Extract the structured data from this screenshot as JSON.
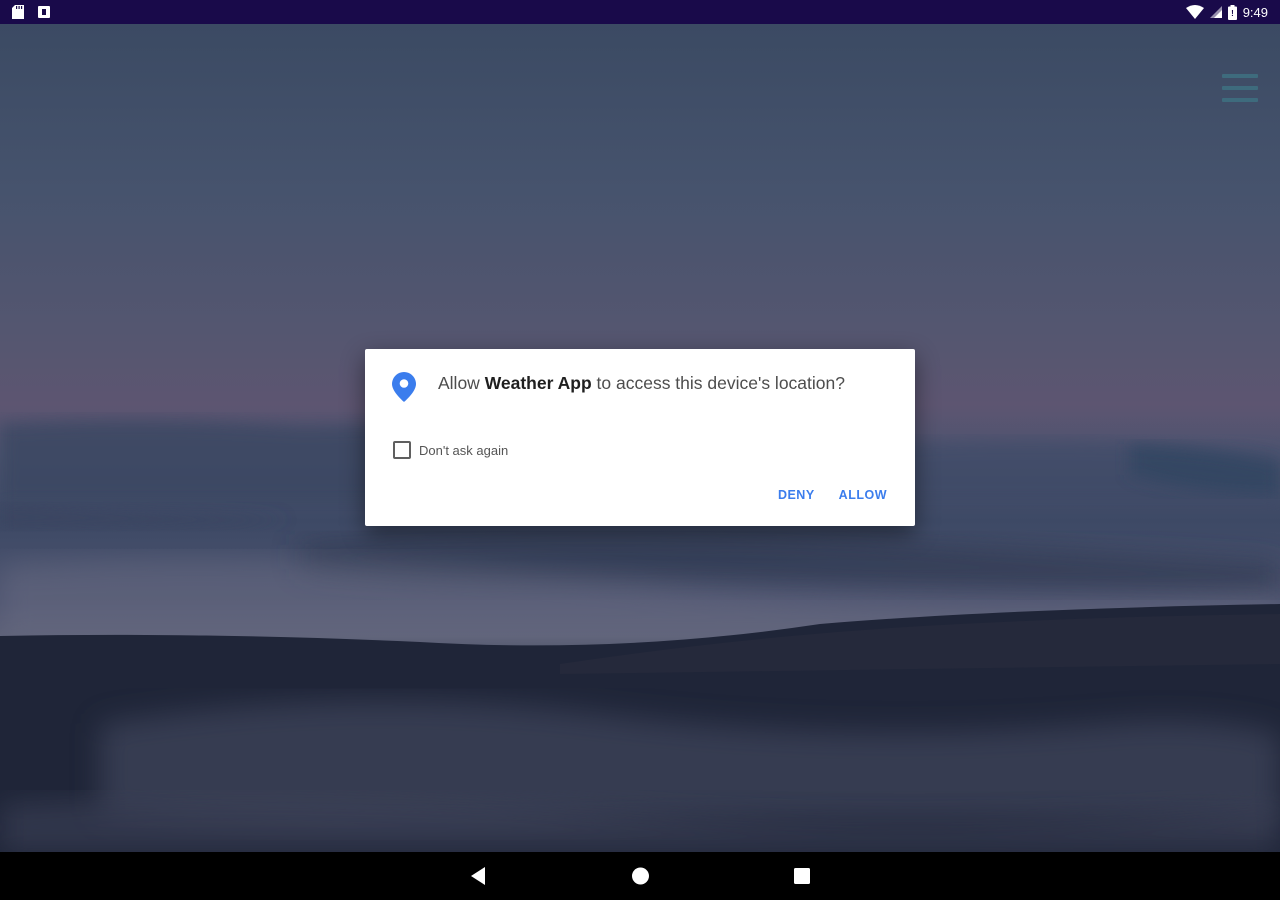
{
  "status_bar": {
    "time": "9:49",
    "left_icons": [
      "sd-card-icon",
      "notification-icon"
    ],
    "right_icons": [
      "wifi-icon",
      "cell-signal-icon",
      "battery-icon"
    ]
  },
  "app": {
    "menu_icon": "hamburger-menu-icon"
  },
  "dialog": {
    "icon": "location-pin-icon",
    "message_prefix": "Allow ",
    "app_name": "Weather App",
    "message_suffix": " to access this device's location?",
    "checkbox_label": "Don't ask again",
    "checkbox_checked": false,
    "deny_label": "DENY",
    "allow_label": "ALLOW",
    "accent_color": "#3b7ded"
  },
  "nav_bar": {
    "buttons": [
      "back-icon",
      "home-icon",
      "recent-apps-icon"
    ]
  }
}
